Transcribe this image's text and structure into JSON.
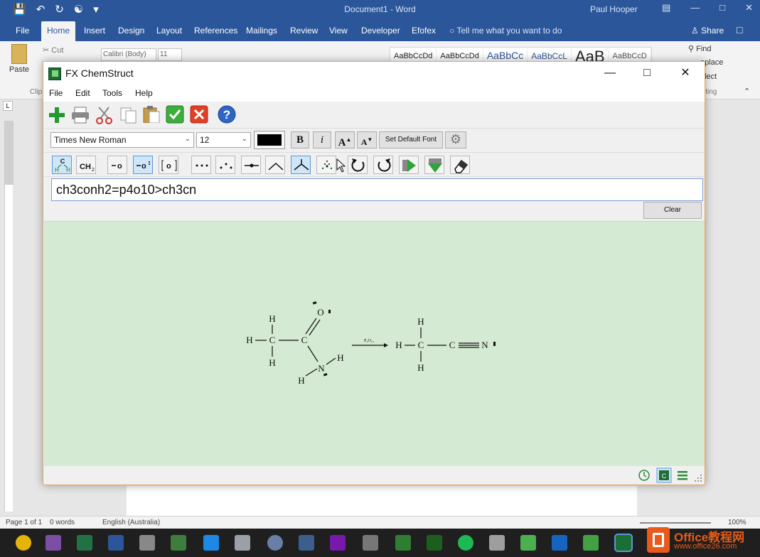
{
  "word": {
    "title": "Document1 - Word",
    "user": "Paul Hooper",
    "tabs": [
      "File",
      "Home",
      "Insert",
      "Design",
      "Layout",
      "References",
      "Mailings",
      "Review",
      "View",
      "Developer",
      "Efofex"
    ],
    "tell_me": "Tell me what you want to do",
    "share": "Share",
    "ribbon": {
      "paste": "Paste",
      "cut": "Cut",
      "font_name": "Calibri (Body)",
      "font_size": "11",
      "styles": [
        "AaBbCcDd",
        "AaBbCcDd",
        "AaBbCc",
        "AaBbCcL",
        "AaB",
        "AaBbCcD"
      ],
      "find": "Find",
      "replace": "eplace",
      "select": "elect",
      "clipboard_label": "Clip",
      "editing_label": "iting"
    },
    "status": {
      "page": "Page 1 of 1",
      "words": "0 words",
      "language": "English (Australia)",
      "zoom": "100%"
    }
  },
  "chem": {
    "title": "FX ChemStruct",
    "menu": [
      "File",
      "Edit",
      "Tools",
      "Help"
    ],
    "font_name": "Times New Roman",
    "font_size": "12",
    "bold_label": "B",
    "italic_label": "i",
    "grow_label": "A",
    "shrink_label": "A",
    "set_default_font": "Set Default Font",
    "formula": "ch3conh2=p4o10>ch3cn",
    "clear": "Clear",
    "colors": {
      "font_color": "#000000",
      "canvas": "#d5ead2",
      "accent": "#5a9bd5"
    },
    "structure": {
      "reactant": {
        "atoms": [
          "H",
          "H",
          "H",
          "C",
          "C",
          "O",
          "N",
          "H",
          "H"
        ]
      },
      "reagent": "P₄O₁₀",
      "product": {
        "atoms": [
          "H",
          "H",
          "H",
          "C",
          "C",
          "N"
        ]
      }
    }
  },
  "logo": {
    "line1": "Office教程网",
    "line2": "www.office26.com"
  }
}
